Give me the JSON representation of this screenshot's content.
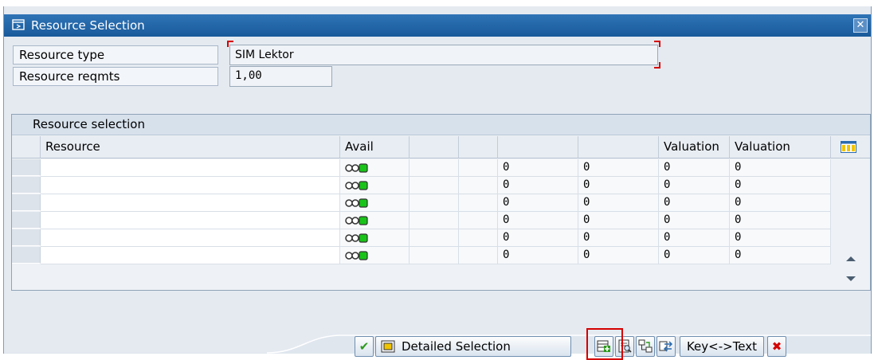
{
  "dialog": {
    "title": "Resource Selection",
    "close_glyph": "✕"
  },
  "form": {
    "resource_type_label": "Resource type",
    "resource_type_value": "SIM Lektor",
    "resource_reqmts_label": "Resource reqmts",
    "resource_reqmts_value": "1,00"
  },
  "grid": {
    "title": "Resource selection",
    "columns": [
      "Resource",
      "Avail",
      "",
      "",
      "",
      "",
      "Valuation"
    ],
    "rows": [
      {
        "resource": "",
        "c4": "0",
        "c5": "0",
        "c6": "0",
        "valuation": "0"
      },
      {
        "resource": "",
        "c4": "0",
        "c5": "0",
        "c6": "0",
        "valuation": "0"
      },
      {
        "resource": "",
        "c4": "0",
        "c5": "0",
        "c6": "0",
        "valuation": "0"
      },
      {
        "resource": "",
        "c4": "0",
        "c5": "0",
        "c6": "0",
        "valuation": "0"
      },
      {
        "resource": "",
        "c4": "0",
        "c5": "0",
        "c6": "0",
        "valuation": "0"
      },
      {
        "resource": "",
        "c4": "0",
        "c5": "0",
        "c6": "0",
        "valuation": "0"
      }
    ],
    "availability_icon": "traffic-light-green-icon"
  },
  "buttons": {
    "confirm_glyph": "✔",
    "detailed_selection": "Detailed Selection",
    "key_text": "Key<->Text",
    "cancel_glyph": "✖"
  },
  "colors": {
    "title_bar": "#2f74b6",
    "highlight": "#d40000",
    "cancel": "#d40000"
  }
}
